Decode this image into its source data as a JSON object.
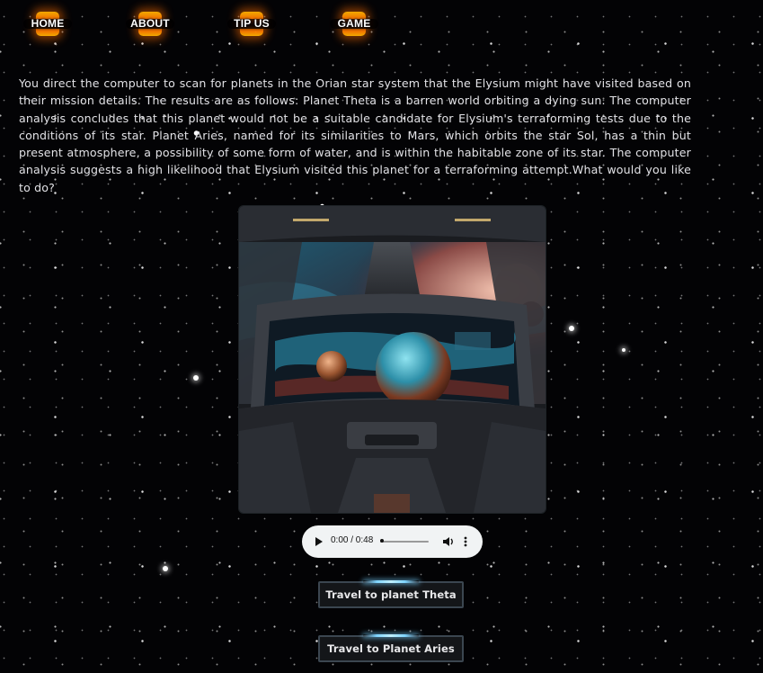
{
  "nav": {
    "items": [
      {
        "label": "HOME"
      },
      {
        "label": "ABOUT"
      },
      {
        "label": "TIP US"
      },
      {
        "label": "GAME"
      }
    ]
  },
  "story": {
    "text": "You direct the computer to scan for planets in the Orian star system that the Elysium might have visited based on their mission details. The results are as follows: Planet Theta is a barren world orbiting a dying sun. The computer analysis concludes that this planet would not be a suitable candidate for Elysium's terraforming tests due to the conditions of its star. Planet Aries, named for its similarities to Mars, which orbits the star Sol, has a thin but present atmosphere, a possibility of some form of water, and is within the habitable zone of its star. The computer analysis suggests a high likelihood that Elysium visited this planet for a terraforming attempt.What would you like to do?"
  },
  "audio": {
    "time": "0:00 / 0:48",
    "progress": 0
  },
  "choices": [
    {
      "label": "Travel to planet Theta"
    },
    {
      "label": "Travel to Planet Aries"
    }
  ],
  "colors": {
    "background": "#030305",
    "nav_glow": "#ff7a00",
    "button_accent": "#7fd4ff",
    "button_border": "#3b4650"
  }
}
